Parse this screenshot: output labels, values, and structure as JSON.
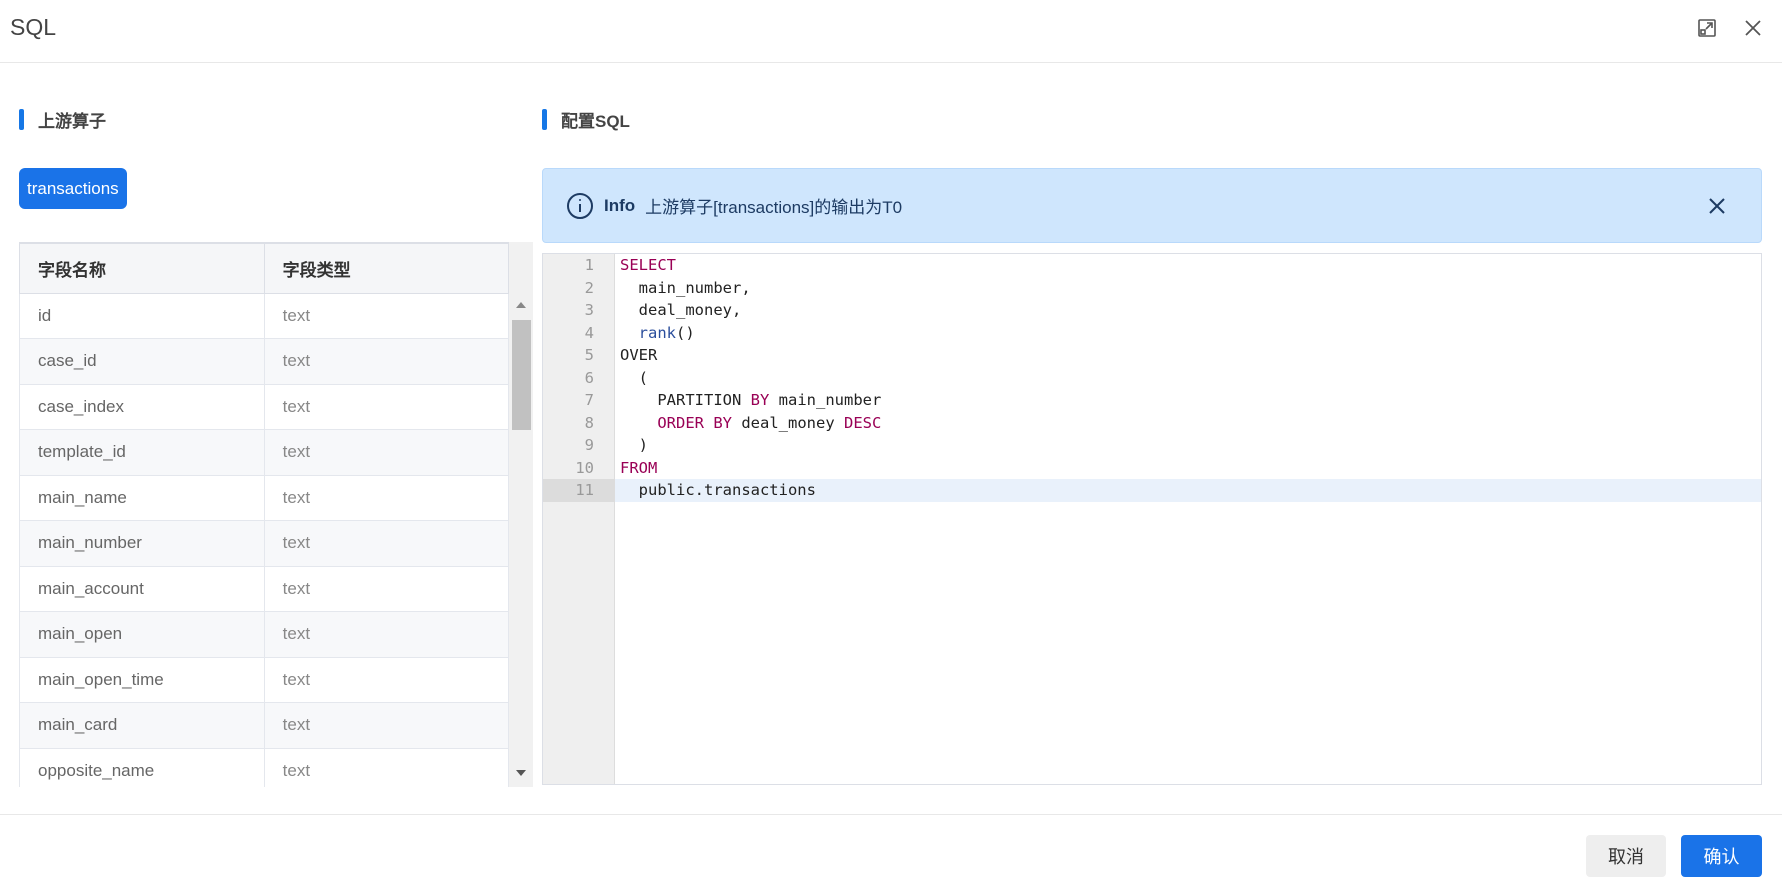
{
  "dialog": {
    "title": "SQL"
  },
  "left": {
    "section_title": "上游算子",
    "tag": "transactions",
    "table": {
      "headers": [
        "字段名称",
        "字段类型"
      ],
      "rows": [
        [
          "id",
          "text"
        ],
        [
          "case_id",
          "text"
        ],
        [
          "case_index",
          "text"
        ],
        [
          "template_id",
          "text"
        ],
        [
          "main_name",
          "text"
        ],
        [
          "main_number",
          "text"
        ],
        [
          "main_account",
          "text"
        ],
        [
          "main_open",
          "text"
        ],
        [
          "main_open_time",
          "text"
        ],
        [
          "main_card",
          "text"
        ],
        [
          "opposite_name",
          "text"
        ]
      ]
    }
  },
  "right": {
    "section_title": "配置SQL",
    "alert": {
      "title": "Info",
      "message": "上游算子[transactions]的输出为T0"
    },
    "editor": {
      "active_line": 11,
      "lines": [
        "SELECT",
        "  main_number,",
        "  deal_money,",
        "  rank()",
        "OVER",
        "  (",
        "    PARTITION BY main_number",
        "    ORDER BY deal_money DESC",
        "  )",
        "FROM",
        "  public.transactions"
      ]
    }
  },
  "footer": {
    "cancel_label": "取消",
    "ok_label": "确认"
  },
  "colors": {
    "primary": "#1a73e8",
    "alert_bg": "#cfe6fd",
    "keyword": "#990055"
  }
}
